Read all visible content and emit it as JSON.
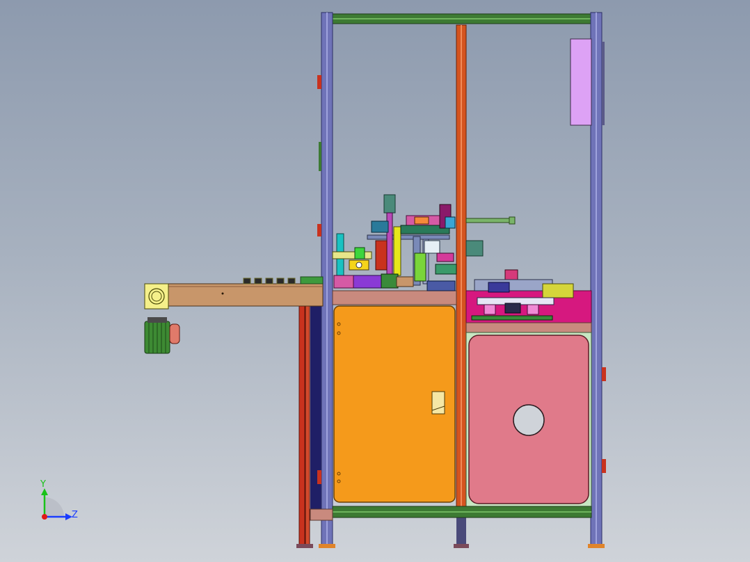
{
  "viewport": {
    "kind": "CAD side view of an automated assembly machine",
    "background_top": "#8d9aae",
    "background_bottom": "#cfd3d9"
  },
  "colors": {
    "frame_upright": "#6f73b8",
    "frame_crossbar": "#3d7a33",
    "orange_panel": "#f59a1b",
    "pink_panel": "#e07a8a",
    "magenta_bench": "#d6187f",
    "conveyor": "#c8966a",
    "motor": "#3d8a33",
    "red_post": "#c9321e",
    "lilac_box": "#dda2f5",
    "dark_blue_side": "#1f1f66"
  },
  "triad": {
    "y_label": "Y",
    "z_label": "Z",
    "y_color": "#19c219",
    "z_color": "#1a3cff",
    "origin_color": "#e01919"
  }
}
